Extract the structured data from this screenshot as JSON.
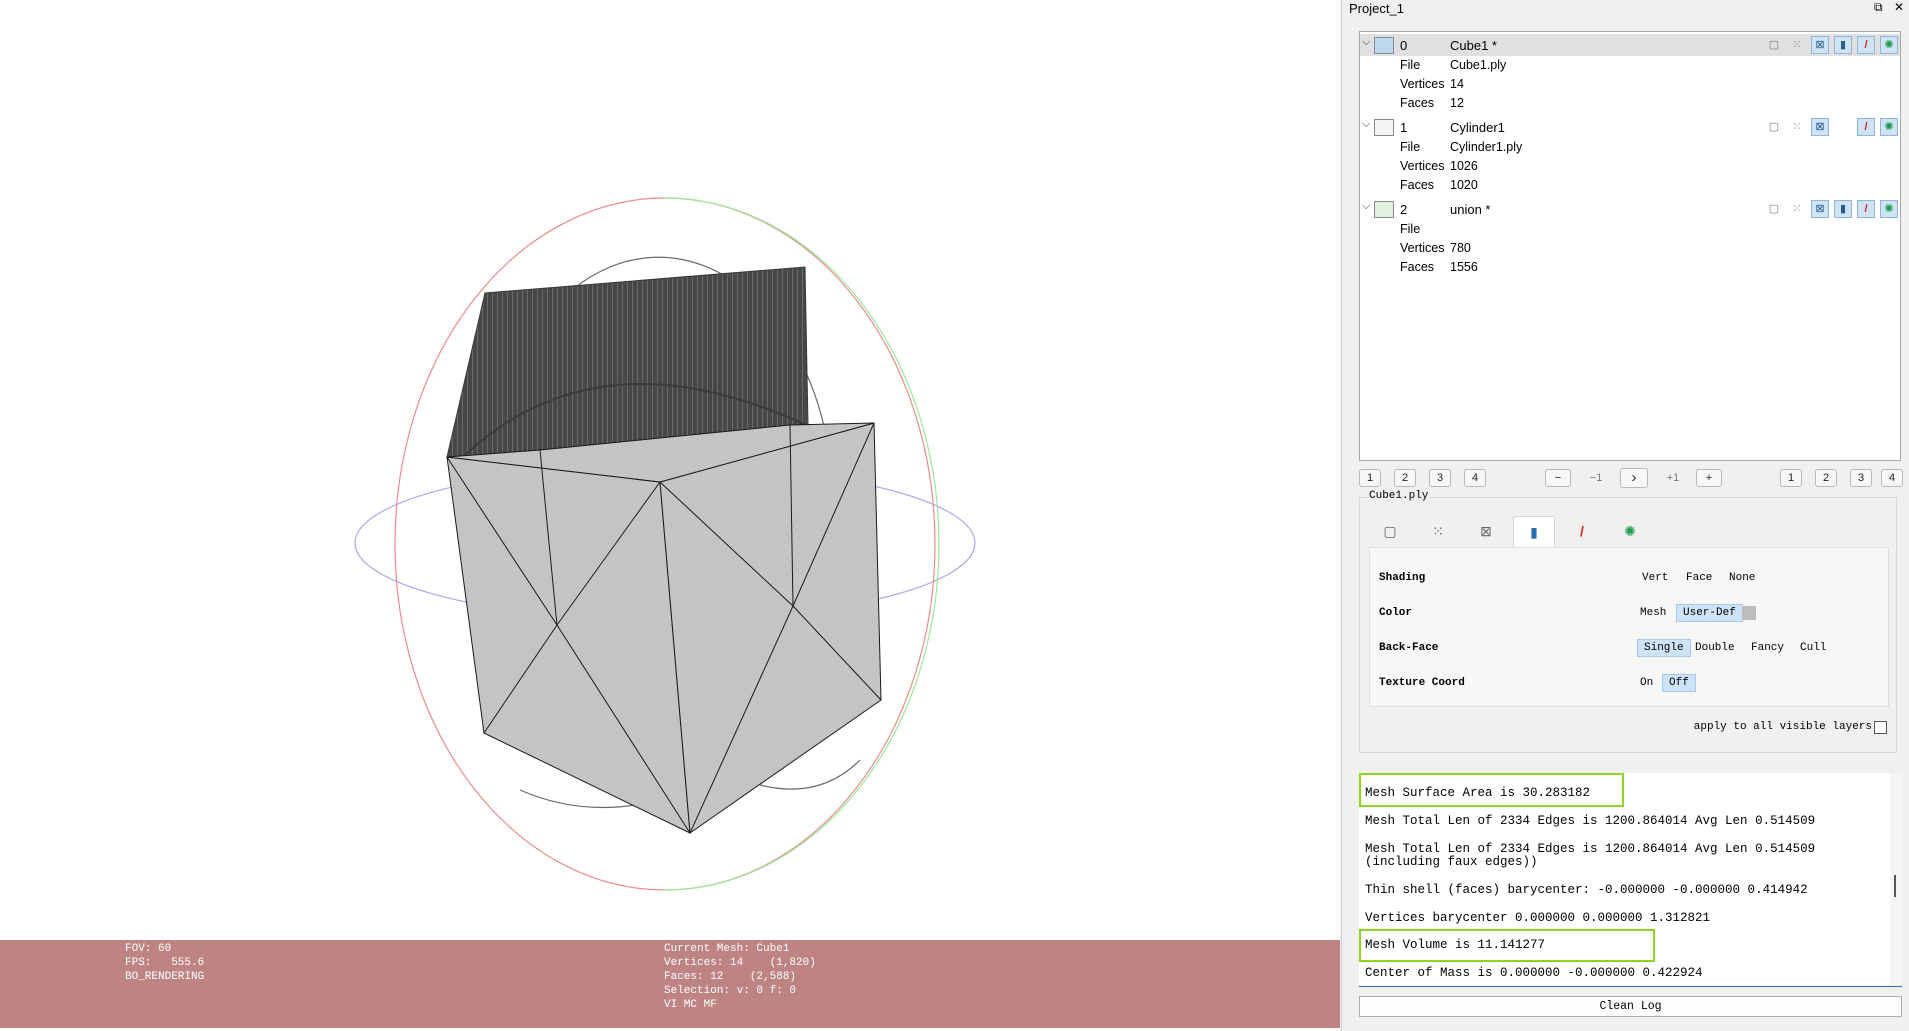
{
  "window": {
    "title": "Project_1",
    "restore_icon": "restore-icon",
    "close_icon": "close-icon",
    "restore_glyph": "⧉",
    "close_glyph": "✕"
  },
  "layers": [
    {
      "index": "0",
      "name": "Cube1 *",
      "file_label": "File",
      "file": "Cube1.ply",
      "vertices_label": "Vertices",
      "vertices": "14",
      "faces_label": "Faces",
      "faces": "12",
      "selected": true
    },
    {
      "index": "1",
      "name": "Cylinder1",
      "file_label": "File",
      "file": "Cylinder1.ply",
      "vertices_label": "Vertices",
      "vertices": "1026",
      "faces_label": "Faces",
      "faces": "1020",
      "selected": false
    },
    {
      "index": "2",
      "name": "union *",
      "file_label": "File",
      "file": "",
      "vertices_label": "Vertices",
      "vertices": "780",
      "faces_label": "Faces",
      "faces": "1556",
      "selected": false
    }
  ],
  "nav": {
    "left": [
      "1",
      "2",
      "3",
      "4"
    ],
    "minus": "−",
    "minus1": "−1",
    "next": "›",
    "plus1": "+1",
    "plus": "+",
    "right": [
      "1",
      "2",
      "3",
      "4"
    ]
  },
  "render": {
    "legend": "Cube1.ply",
    "tabs": [
      "box-icon",
      "points-icon",
      "wire-icon",
      "solid-icon",
      "texture-icon",
      "select-icon"
    ],
    "shading_label": "Shading",
    "shading_opts": [
      "Vert",
      "Face",
      "None"
    ],
    "color_label": "Color",
    "color_opts": [
      "Mesh",
      "User-Def"
    ],
    "backface_label": "Back-Face",
    "backface_opts": [
      "Single",
      "Double",
      "Fancy",
      "Cull"
    ],
    "texcoord_label": "Texture Coord",
    "texcoord_opts": [
      "On",
      "Off"
    ],
    "apply_label": "apply to all visible layers"
  },
  "log": [
    "Mesh Surface Area is 30.283182",
    "Mesh Total Len of 2334 Edges is 1200.864014 Avg Len 0.514509",
    "Mesh Total Len of 2334 Edges is 1200.864014 Avg Len 0.514509",
    "(including faux edges))",
    "Thin shell (faces) barycenter: -0.000000 -0.000000 0.414942",
    "Vertices barycenter 0.000000 0.000000 1.312821",
    "Mesh Volume is 11.141277",
    "Center of Mass is 0.000000 -0.000000 0.422924"
  ],
  "clean_log": "Clean Log",
  "hud": {
    "fov": "FOV: 60",
    "fps": "FPS:   555.6",
    "mode": "BO_RENDERING",
    "current_mesh": "Current Mesh: Cube1",
    "vertices": "Vertices: 14    (1,820)",
    "faces": "Faces: 12    (2,588)",
    "selection": "Selection: v: 0 f: 0",
    "flags": "VI MC MF"
  },
  "colors": {
    "hud_bg": "#bd8483",
    "highlight": "#8ed61c",
    "selected_btn": "#cfe3f5",
    "cube_fill": "#c4c4c4",
    "cylinder_fill": "#474747"
  }
}
